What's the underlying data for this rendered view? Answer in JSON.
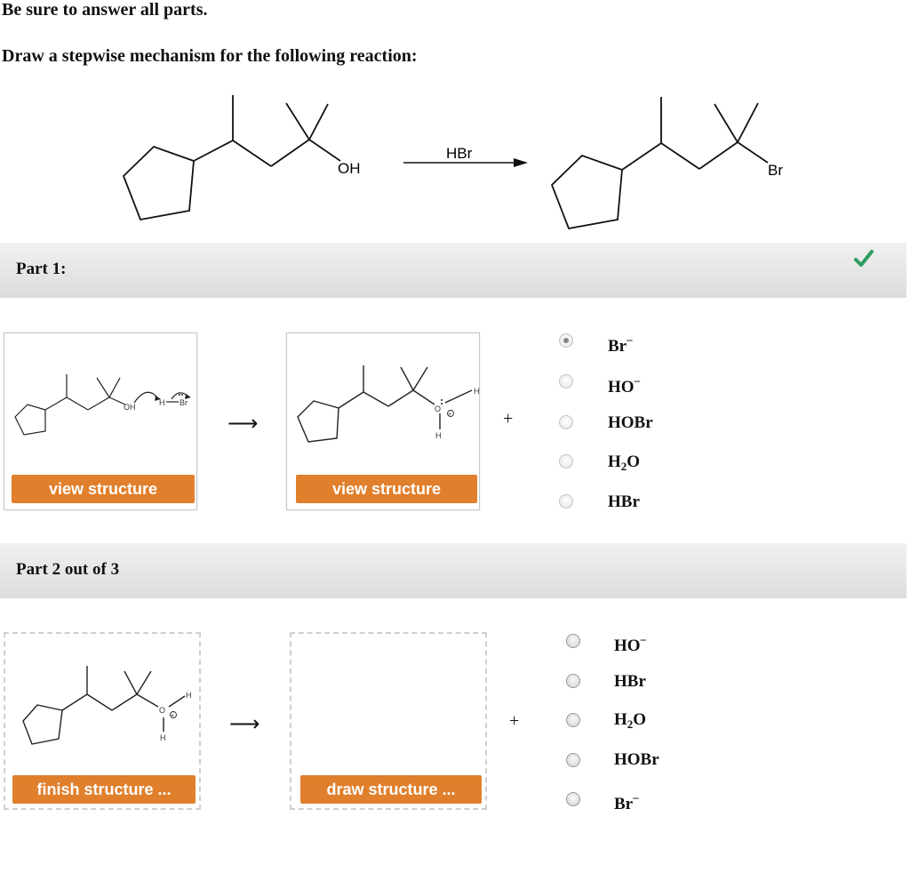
{
  "instructions": {
    "answer_all": "Be sure to answer all parts.",
    "question": "Draw a stepwise mechanism for the following reaction:"
  },
  "reaction": {
    "reactant_group": "OH",
    "reagent": "HBr",
    "product_group": "Br"
  },
  "part1": {
    "title": "Part 1:",
    "status_icon": "checkmark-icon",
    "status_color": "#2e9c5e",
    "box1_button": "view structure",
    "box2_button": "view structure",
    "arrow": "⟶",
    "plus": "+",
    "atom_labels": {
      "oh": "OH",
      "h": "H",
      "br": "Br",
      "o": "O",
      "h_top": "H",
      "h_bottom": "H"
    },
    "options": [
      {
        "base": "Br",
        "sup": "–",
        "sub": "",
        "selected": true
      },
      {
        "base": "HO",
        "sup": "–",
        "sub": "",
        "selected": false
      },
      {
        "base": "HOBr",
        "sup": "",
        "sub": "",
        "selected": false
      },
      {
        "base": "H",
        "sub": "2",
        "tail": "O",
        "sup": "",
        "selected": false
      },
      {
        "base": "HBr",
        "sup": "",
        "sub": "",
        "selected": false
      }
    ]
  },
  "part2": {
    "title": "Part 2 out of 3",
    "box1_button": "finish structure ...",
    "box2_button": "draw structure ...",
    "arrow": "⟶",
    "plus": "+",
    "atom_labels": {
      "o": "O",
      "h_top": "H",
      "h_bottom": "H"
    },
    "options": [
      {
        "base": "HO",
        "sup": "–",
        "sub": ""
      },
      {
        "base": "HBr",
        "sup": "",
        "sub": ""
      },
      {
        "base": "H",
        "sub": "2",
        "tail": "O",
        "sup": ""
      },
      {
        "base": "HOBr",
        "sup": "",
        "sub": ""
      },
      {
        "base": "Br",
        "sup": "–",
        "sub": ""
      }
    ]
  },
  "colors": {
    "button_orange": "#e07f2c",
    "panel_gray": "#e6e6e6"
  }
}
